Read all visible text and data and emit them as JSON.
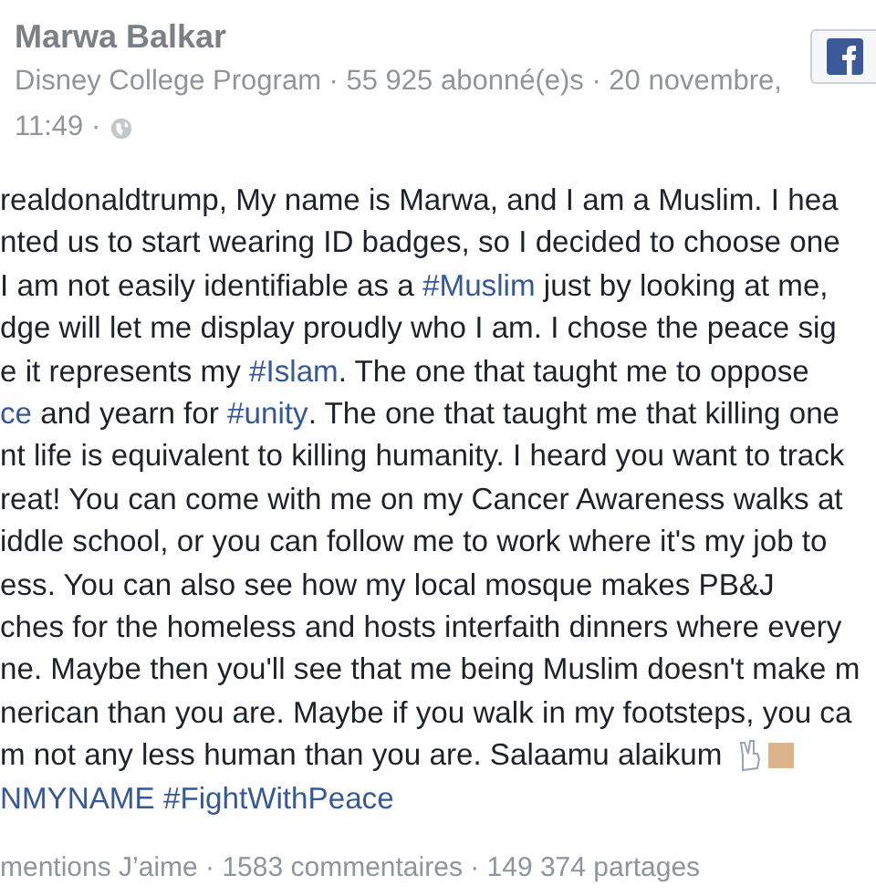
{
  "post": {
    "author": "Marwa Balkar",
    "meta": "Disney College Program · 55 925 abonné(e)s · 20 novembre,",
    "time": "11:49 ·",
    "lines": [
      [
        {
          "kind": "text",
          "text": "realdonaldtrump, My name is Marwa, and I am a Muslim. I hea"
        }
      ],
      [
        {
          "kind": "text",
          "text": "nted us to start wearing ID badges, so I decided to choose one"
        }
      ],
      [
        {
          "kind": "text",
          "text": "I am not easily identifiable as a "
        },
        {
          "kind": "hashtag",
          "text": "#Muslim"
        },
        {
          "kind": "text",
          "text": " just by looking at me,"
        }
      ],
      [
        {
          "kind": "text",
          "text": "dge will let me display proudly who I am. I chose the peace sig"
        }
      ],
      [
        {
          "kind": "text",
          "text": "e it represents my "
        },
        {
          "kind": "hashtag",
          "text": "#Islam"
        },
        {
          "kind": "text",
          "text": ". The one that taught me to oppose"
        }
      ],
      [
        {
          "kind": "hashtag",
          "text": "ce"
        },
        {
          "kind": "text",
          "text": " and yearn for "
        },
        {
          "kind": "hashtag",
          "text": "#unity"
        },
        {
          "kind": "text",
          "text": ". The one that taught me that killing one"
        }
      ],
      [
        {
          "kind": "text",
          "text": "nt life is equivalent to killing humanity. I heard you want to track"
        }
      ],
      [
        {
          "kind": "text",
          "text": "reat! You can come with me on my Cancer Awareness walks at"
        }
      ],
      [
        {
          "kind": "text",
          "text": "iddle school, or you can follow me to work where it's my job to"
        }
      ],
      [
        {
          "kind": "text",
          "text": "ess. You can also see how my local mosque makes PB&J"
        }
      ],
      [
        {
          "kind": "text",
          "text": "ches for the homeless and hosts interfaith dinners where every"
        }
      ],
      [
        {
          "kind": "text",
          "text": "ne. Maybe then you'll see that me being Muslim doesn't make m"
        }
      ],
      [
        {
          "kind": "text",
          "text": "nerican than you are. Maybe if you walk in my footsteps, you ca"
        }
      ],
      [
        {
          "kind": "text",
          "text": "m not any less human than you are. Salaamu alaikum"
        },
        {
          "kind": "emoji"
        }
      ],
      [
        {
          "kind": "hashtag",
          "text": "NMYNAME"
        },
        {
          "kind": "hashtag",
          "text": "#FightWithPeace"
        }
      ]
    ],
    "stats": "mentions J’aime · 1583 commentaires · 149 374 partages"
  }
}
